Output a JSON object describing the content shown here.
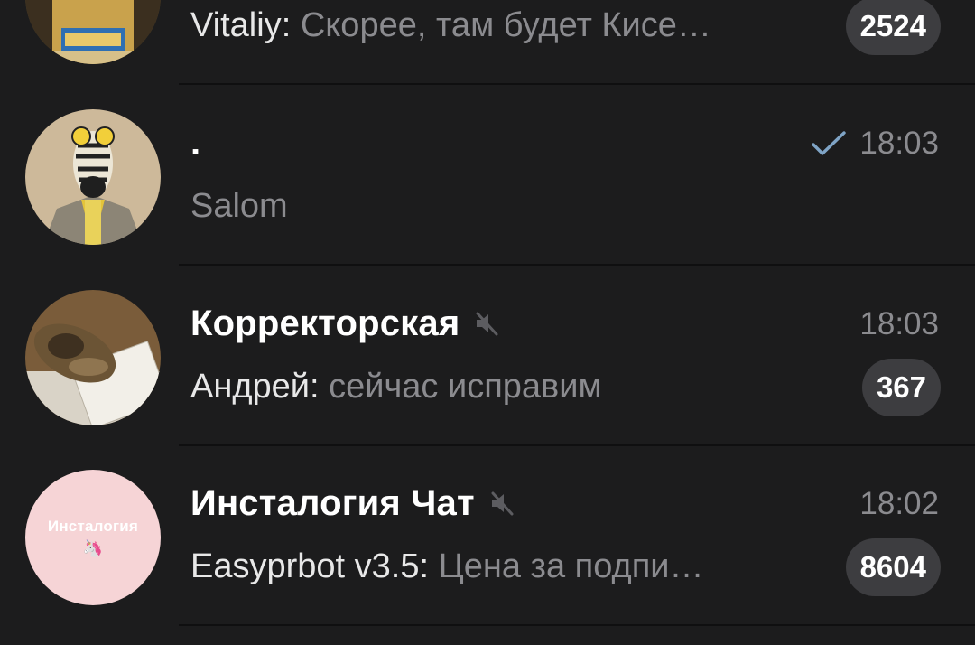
{
  "colors": {
    "background": "#1c1c1d",
    "divider": "#0f0f10",
    "title": "#ffffff",
    "secondary_text": "#8b8b8f",
    "badge_background": "#3d3d40",
    "check_mark": "#7fa4c6"
  },
  "chats": [
    {
      "title": "",
      "time": "",
      "muted": false,
      "read_check": false,
      "preview_sender": "Vitaliy",
      "preview_text": "Скорее, там будет Кисе…",
      "unread_count": "2524",
      "avatar_icon": "bottle-photo-avatar"
    },
    {
      "title": ".",
      "time": "18:03",
      "muted": false,
      "read_check": true,
      "preview_sender": "",
      "preview_text": "Salom",
      "unread_count": "",
      "avatar_icon": "zebra-illustration-avatar"
    },
    {
      "title": "Корректорская",
      "time": "18:03",
      "muted": true,
      "read_check": false,
      "preview_sender": "Андрей",
      "preview_text": "сейчас исправим",
      "unread_count": "367",
      "avatar_icon": "cat-on-keyboard-avatar"
    },
    {
      "title": "Инсталогия Чат",
      "time": "18:02",
      "muted": true,
      "read_check": false,
      "preview_sender": "Easyprbot v3.5",
      "preview_text": "Цена за подпи…",
      "unread_count": "8604",
      "avatar_icon": "instalogia-logo-avatar",
      "avatar_text": "Инсталогия",
      "avatar_emoji": "🦄"
    }
  ]
}
